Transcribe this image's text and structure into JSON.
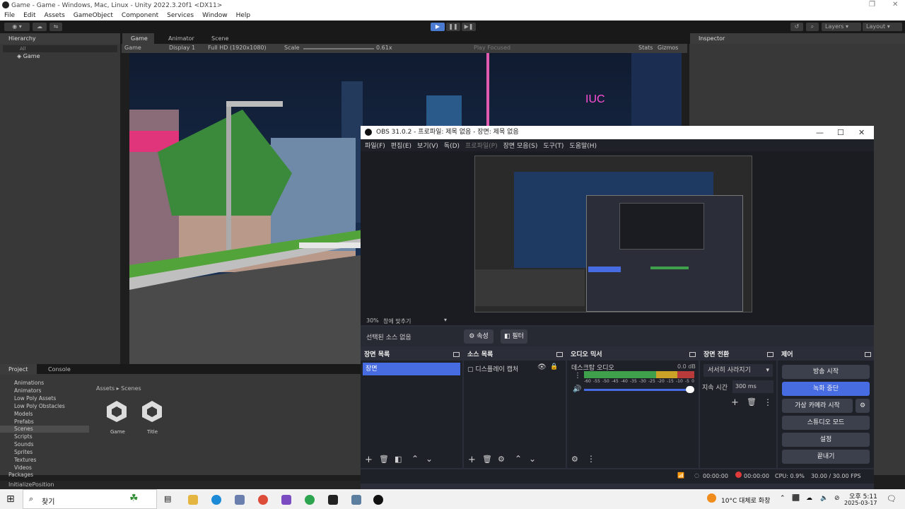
{
  "unity": {
    "title": "Game - Game - Windows, Mac, Linux - Unity 2022.3.20f1 <DX11>",
    "menu": [
      "File",
      "Edit",
      "Assets",
      "GameObject",
      "Component",
      "Services",
      "Window",
      "Help"
    ],
    "toolbar": {
      "layers": "Layers",
      "layout": "Layout"
    },
    "tabs": {
      "hierarchy": "Hierarchy",
      "game": "Game",
      "animator": "Animator",
      "scene": "Scene",
      "inspector": "Inspector",
      "project": "Project",
      "console": "Console"
    },
    "hierarchy": {
      "search_placeholder": "All",
      "root": "Game"
    },
    "game_bar": {
      "mode": "Game",
      "display": "Display 1",
      "resolution": "Full HD (1920x1080)",
      "scale_label": "Scale",
      "scale_value": "0.61x",
      "play_focused": "Play Focused",
      "stats": "Stats",
      "gizmos": "Gizmos"
    },
    "project": {
      "folders": [
        "Animations",
        "Animators",
        "Low Poly Assets",
        "Low Poly Obstacles",
        "Models",
        "Prefabs",
        "Scenes",
        "Scripts",
        "Sounds",
        "Sprites",
        "Textures",
        "Videos"
      ],
      "selected_folder": "Scenes",
      "packages": "Packages",
      "breadcrumb": [
        "Assets",
        "Scenes"
      ],
      "assets": [
        "Game",
        "Title"
      ]
    },
    "status": "InitializePosition",
    "game_sign": "IUC"
  },
  "obs": {
    "title": "OBS 31.0.2 - 프로파일: 제목 없음 - 장면: 제목 없음",
    "menu": [
      "파일(F)",
      "편집(E)",
      "보기(V)",
      "독(D)",
      "프로파일(P)",
      "장면 모음(S)",
      "도구(T)",
      "도움말(H)"
    ],
    "zoom": "30%",
    "zoom_mode": "창에 맞추기",
    "no_source": "선택된 소스 없음",
    "props": "속성",
    "filters": "필터",
    "docks": {
      "scenes": {
        "title": "장면 목록",
        "items": [
          "장면"
        ]
      },
      "sources": {
        "title": "소스 목록",
        "items": [
          "디스플레이 캡처"
        ]
      },
      "mixer": {
        "title": "오디오 믹서",
        "channel": "데스크탑 오디오",
        "db": "0.0 dB",
        "ticks": [
          "-60",
          "-55",
          "-50",
          "-45",
          "-40",
          "-35",
          "-30",
          "-25",
          "-20",
          "-15",
          "-10",
          "-5",
          "0"
        ]
      },
      "transitions": {
        "title": "장면 전환",
        "type": "서서히 사라지기",
        "duration_label": "지속 시간",
        "duration": "300 ms"
      },
      "controls": {
        "title": "제어",
        "buttons": [
          "방송 시작",
          "녹화 중단",
          "가상 카메라 시작",
          "스튜디오 모드",
          "설정",
          "끝내기"
        ]
      }
    },
    "status": {
      "stream_time": "00:00:00",
      "rec_time": "00:00:00",
      "cpu": "CPU: 0.9%",
      "fps": "30.00 / 30.00 FPS"
    }
  },
  "taskbar": {
    "search": "찾기",
    "weather": "10°C  대체로 화창",
    "time": "오후 5:11",
    "date": "2025-03-17"
  }
}
